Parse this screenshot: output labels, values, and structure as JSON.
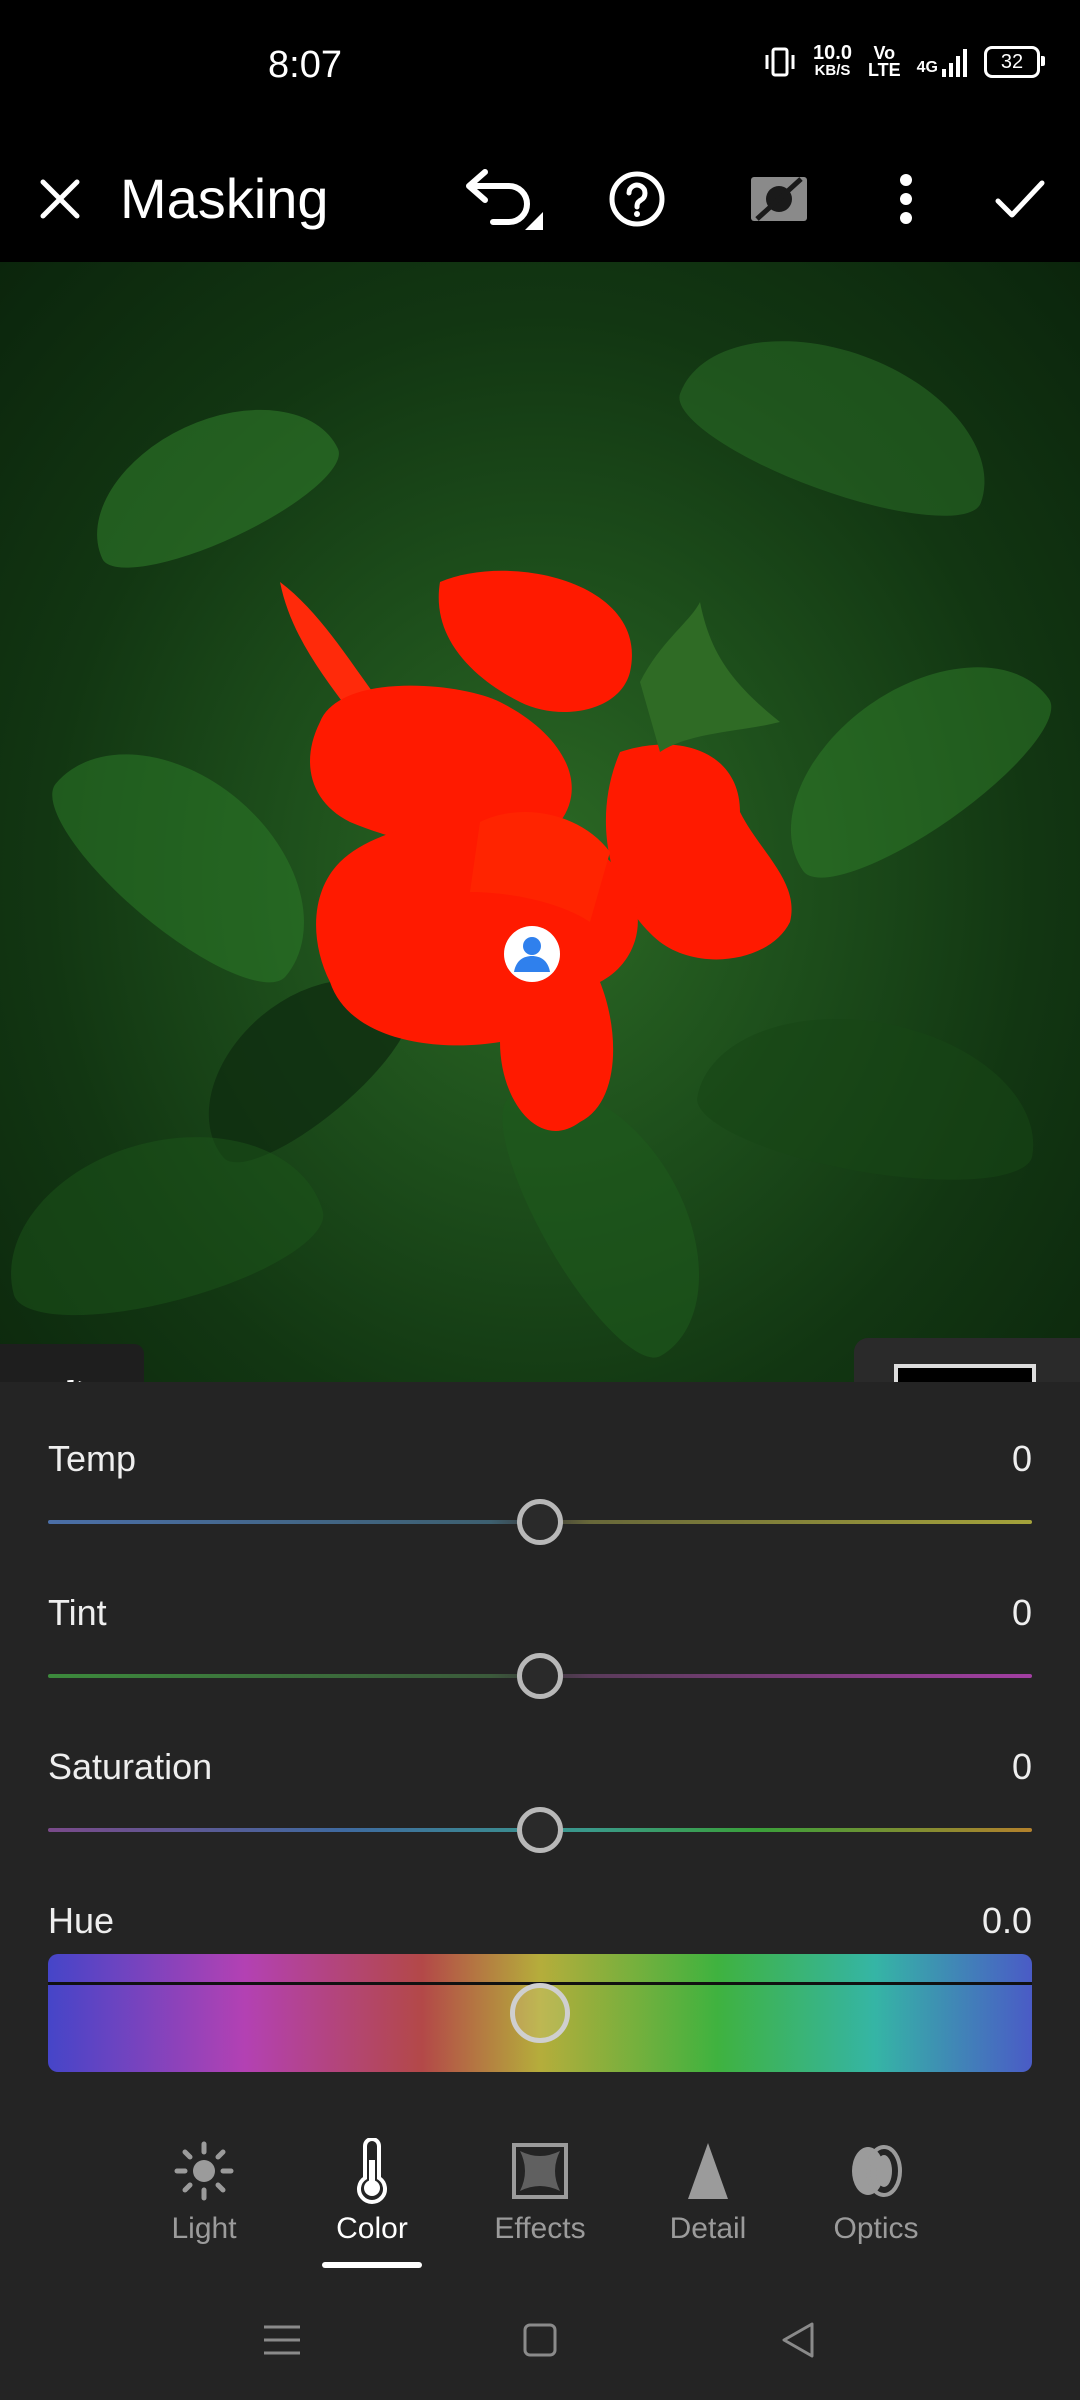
{
  "status_bar": {
    "time": "8:07",
    "net_speed_value": "10.0",
    "net_speed_unit": "KB/S",
    "volte_top": "Vo",
    "volte_bottom": "LTE",
    "network": "4G",
    "battery": "32"
  },
  "app_bar": {
    "title": "Masking",
    "icons": [
      "close-icon",
      "undo-icon",
      "help-icon",
      "mask-overlay-hidden-icon",
      "more-icon",
      "confirm-icon"
    ]
  },
  "overlay": {
    "mask_color": "#ff1a00",
    "selected_mask": "select-subject"
  },
  "adjustments": {
    "temp": {
      "label": "Temp",
      "value": "0"
    },
    "tint": {
      "label": "Tint",
      "value": "0"
    },
    "saturation": {
      "label": "Saturation",
      "value": "0"
    },
    "hue": {
      "label": "Hue",
      "value": "0.0"
    }
  },
  "tabs": [
    {
      "label": "Light",
      "icon": "sun-icon",
      "active": false
    },
    {
      "label": "Color",
      "icon": "thermometer-icon",
      "active": true
    },
    {
      "label": "Effects",
      "icon": "effects-icon",
      "active": false
    },
    {
      "label": "Detail",
      "icon": "detail-icon",
      "active": false
    },
    {
      "label": "Optics",
      "icon": "optics-icon",
      "active": false
    }
  ],
  "navigation": [
    "menu-icon",
    "home-icon",
    "back-icon"
  ]
}
